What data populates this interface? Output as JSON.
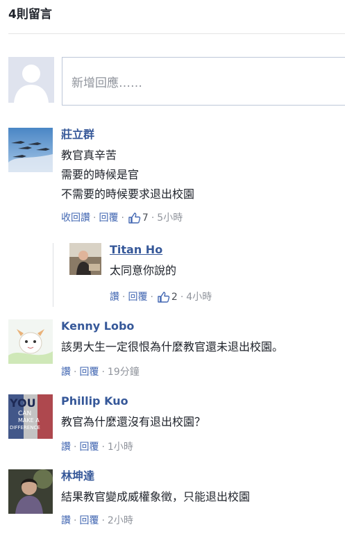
{
  "header": {
    "count_label": "4則留言"
  },
  "compose": {
    "placeholder": "新增回應……"
  },
  "comments": [
    {
      "author": "莊立群",
      "text": "教官真辛苦\n需要的時候是官\n不需要的時候要求退出校園",
      "actions": {
        "like": "收回讚",
        "reply": "回覆",
        "likes": "7",
        "time": "5小時"
      }
    },
    {
      "author": "Kenny Lobo",
      "text": "該男大生一定很恨為什麼教官還未退出校園。",
      "actions": {
        "like": "讚",
        "reply": "回覆",
        "time": "19分鐘"
      }
    },
    {
      "author": "Phillip Kuo",
      "text": "教官為什麼還沒有退出校園？",
      "actions": {
        "like": "讚",
        "reply": "回覆",
        "time": "1小時"
      }
    },
    {
      "author": "林坤達",
      "text": "結果教官變成威權象徵，只能退出校園",
      "actions": {
        "like": "讚",
        "reply": "回覆",
        "time": "2小時"
      }
    }
  ],
  "reply": {
    "author": "Titan Ho",
    "text": "太同意你說的",
    "actions": {
      "like": "讚",
      "reply": "回覆",
      "likes": "2",
      "time": "4小時"
    }
  },
  "avatar_text": {
    "phillip_line1": "YOU",
    "phillip_line2": "CAN",
    "phillip_line3": "MAKE A",
    "phillip_line4": "DIFFERENCE"
  },
  "colors": {
    "link": "#4267b2",
    "author": "#365899",
    "meta": "#90949c"
  }
}
